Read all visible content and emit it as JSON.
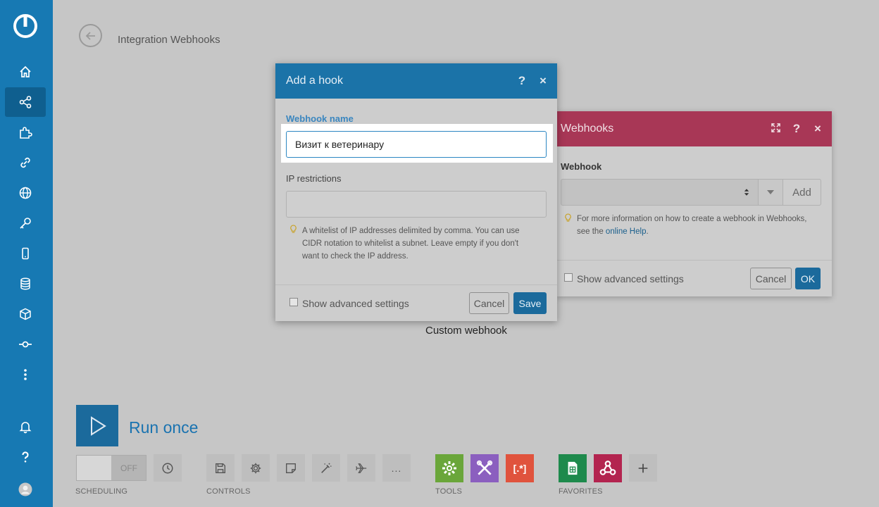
{
  "page": {
    "title": "Integration Webhooks",
    "node_label": "Custom webhook"
  },
  "run": {
    "label": "Run once"
  },
  "toolbar": {
    "scheduling_toggle": "OFF",
    "sections": {
      "scheduling": "SCHEDULING",
      "controls": "CONTROLS",
      "tools": "TOOLS",
      "favorites": "FAVORITES"
    },
    "more": "..."
  },
  "add_hook": {
    "title": "Add a hook",
    "help": "?",
    "close": "×",
    "name_label": "Webhook name",
    "name_value": "Визит к ветеринару",
    "ip_label": "IP restrictions",
    "ip_value": "",
    "ip_hint_1": "A whitelist of IP addresses delimited by comma. You can use",
    "ip_hint_2": "CIDR notation to whitelist a subnet. Leave empty if you don't",
    "ip_hint_3": "want to check the IP address.",
    "advanced": "Show advanced settings",
    "cancel": "Cancel",
    "save": "Save"
  },
  "webhooks_panel": {
    "title": "Webhooks",
    "help": "?",
    "close": "×",
    "field_label": "Webhook",
    "add": "Add",
    "hint_1": "For more information on how to create a webhook in Webhooks,",
    "hint_2_prefix": "see the ",
    "hint_link": "online Help",
    "hint_2_suffix": ".",
    "advanced": "Show advanced settings",
    "cancel": "Cancel",
    "ok": "OK"
  },
  "colors": {
    "sidebar": "#1779b3",
    "primary": "#1b6a9c",
    "webhooks_brand": "#a83756",
    "tools_green": "#6aa63a",
    "tools_purple": "#8b5fbf",
    "tools_orange": "#e0533d",
    "sheets_green": "#1e8a4c",
    "webhooks_tile": "#b3244f"
  }
}
